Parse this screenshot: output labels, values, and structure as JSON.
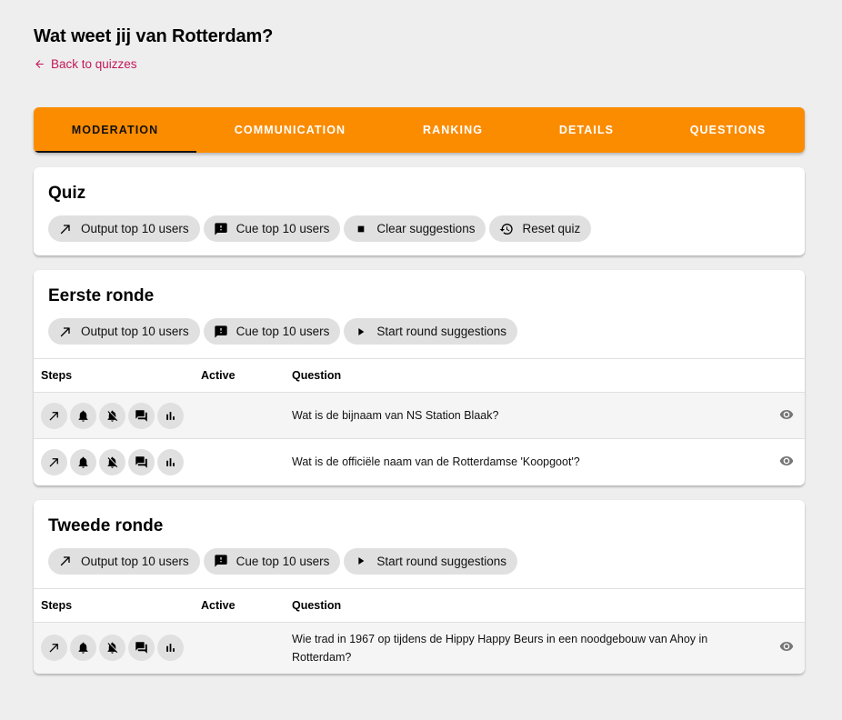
{
  "header": {
    "title": "Wat weet jij van Rotterdam?",
    "back_link": "Back to quizzes",
    "back_icon": "arrow-left-icon"
  },
  "colors": {
    "background": "#eeeeee",
    "tab_bar": "#fb8c00",
    "link": "#c2185b",
    "chip": "#e0e0e0",
    "row_highlight": "#f5f5f5"
  },
  "tabs": [
    {
      "label": "MODERATION",
      "active": true
    },
    {
      "label": "COMMUNICATION",
      "active": false
    },
    {
      "label": "RANKING",
      "active": false
    },
    {
      "label": "DETAILS",
      "active": false
    },
    {
      "label": "QUESTIONS",
      "active": false
    }
  ],
  "quiz_card": {
    "title": "Quiz",
    "actions": [
      {
        "label": "Output top 10 users",
        "icon": "arrow-up-right-icon"
      },
      {
        "label": "Cue top 10 users",
        "icon": "feedback-icon"
      },
      {
        "label": "Clear suggestions",
        "icon": "stop-icon"
      },
      {
        "label": "Reset quiz",
        "icon": "history-icon"
      }
    ]
  },
  "table_headers": {
    "steps": "Steps",
    "active": "Active",
    "question": "Question"
  },
  "step_icons": [
    "arrow-up-right-icon",
    "bell-icon",
    "bell-off-icon",
    "forum-icon",
    "bar-chart-icon"
  ],
  "rounds": [
    {
      "title": "Eerste ronde",
      "actions": [
        {
          "label": "Output top 10 users",
          "icon": "arrow-up-right-icon"
        },
        {
          "label": "Cue top 10 users",
          "icon": "feedback-icon"
        },
        {
          "label": "Start round suggestions",
          "icon": "play-icon"
        }
      ],
      "questions": [
        {
          "active": "",
          "question": "Wat is de bijnaam van NS Station Blaak?"
        },
        {
          "active": "",
          "question": "Wat is de officiële naam van de Rotterdamse 'Koopgoot'?"
        }
      ]
    },
    {
      "title": "Tweede ronde",
      "actions": [
        {
          "label": "Output top 10 users",
          "icon": "arrow-up-right-icon"
        },
        {
          "label": "Cue top 10 users",
          "icon": "feedback-icon"
        },
        {
          "label": "Start round suggestions",
          "icon": "play-icon"
        }
      ],
      "questions": [
        {
          "active": "",
          "question": "Wie trad in 1967 op tijdens de Hippy Happy Beurs in een noodgebouw van Ahoy in Rotterdam?"
        }
      ]
    }
  ]
}
